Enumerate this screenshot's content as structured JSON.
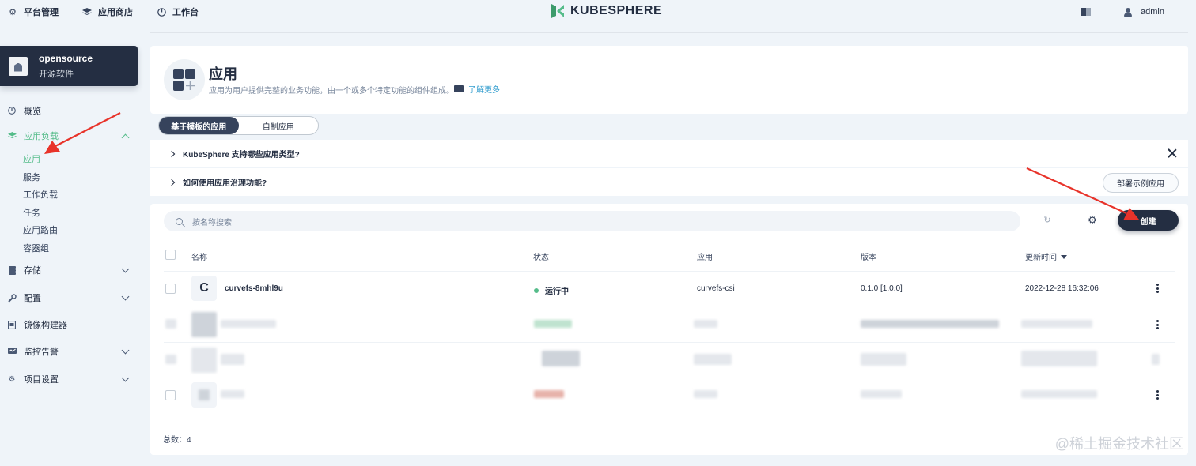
{
  "topbar": {
    "nav": [
      {
        "label": "平台管理",
        "icon": "gear-icon"
      },
      {
        "label": "应用商店",
        "icon": "layers-icon"
      },
      {
        "label": "工作台",
        "icon": "dashboard-icon"
      }
    ],
    "logo_text": "KUBESPHERE",
    "user": "admin"
  },
  "workspace": {
    "name": "opensource",
    "subtitle": "开源软件"
  },
  "sidebar": {
    "overview": "概览",
    "workloads": {
      "label": "应用负载",
      "items": [
        "应用",
        "服务",
        "工作负载",
        "任务",
        "应用路由",
        "容器组"
      ]
    },
    "storage": "存储",
    "config": "配置",
    "image_builder": "镜像构建器",
    "monitoring": "监控告警",
    "project_settings": "项目设置"
  },
  "banner": {
    "title": "应用",
    "description": "应用为用户提供完整的业务功能，由一个或多个特定功能的组件组成。",
    "learn_more": "了解更多"
  },
  "tabs": [
    "基于模板的应用",
    "自制应用"
  ],
  "faq": [
    {
      "question": "KubeSphere 支持哪些应用类型?"
    },
    {
      "question": "如何使用应用治理功能?",
      "action": "部署示例应用"
    }
  ],
  "toolbar": {
    "search_placeholder": "按名称搜索",
    "create_label": "创建"
  },
  "table": {
    "headers": [
      "名称",
      "状态",
      "应用",
      "版本",
      "更新时间"
    ],
    "rows": [
      {
        "badge": "C",
        "name": "curvefs-8mhl9u",
        "status": "运行中",
        "app": "curvefs-csi",
        "version": "0.1.0 [1.0.0]",
        "updated": "2022-12-28 16:32:06"
      }
    ],
    "total": "总数：4"
  },
  "watermark": "@稀土掘金技术社区",
  "colors": {
    "accent": "#55bc8a",
    "dark": "#242e42",
    "link": "#329dce",
    "annotation": "#e8332a"
  }
}
